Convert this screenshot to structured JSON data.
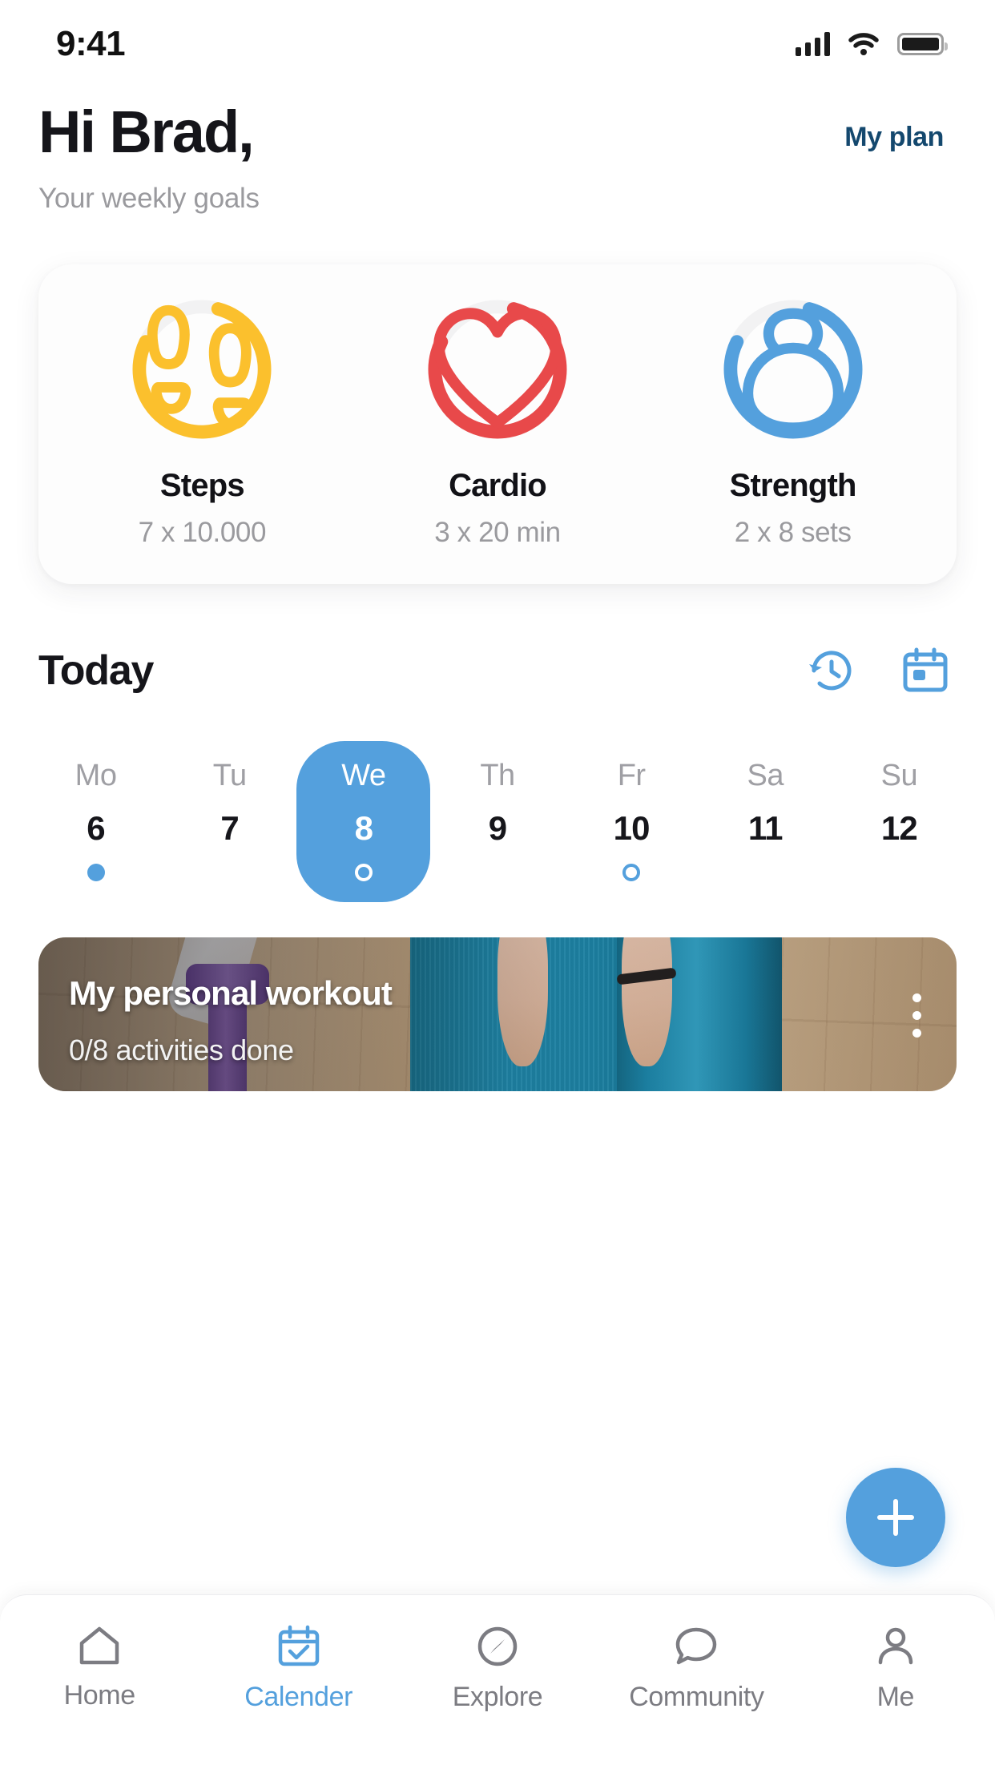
{
  "status": {
    "time": "9:41",
    "signal_icon": "signal-bars-icon",
    "wifi_icon": "wifi-icon",
    "battery_icon": "battery-icon"
  },
  "header": {
    "greeting": "Hi Brad,",
    "subtitle": "Your weekly goals",
    "my_plan_label": "My plan",
    "my_plan_color": "#14486e"
  },
  "goals": [
    {
      "name": "Steps",
      "value": "7 x 10.000",
      "icon": "footprints-icon",
      "color": "#fbc02d",
      "track_color": "#f2f2f3",
      "progress": 78
    },
    {
      "name": "Cardio",
      "value": "3 x 20 min",
      "icon": "heart-icon",
      "color": "#e8494a",
      "track_color": "#f2f2f3",
      "progress": 78
    },
    {
      "name": "Strength",
      "value": "2 x 8 sets",
      "icon": "kettlebell-icon",
      "color": "#54a0dd",
      "track_color": "#f2f2f3",
      "progress": 78
    }
  ],
  "today": {
    "title": "Today",
    "history_icon": "history-clock-icon",
    "calendar_icon": "calendar-icon",
    "icon_color": "#54a0dd"
  },
  "days": [
    {
      "name": "Mo",
      "num": "6",
      "active": false,
      "dot": "filled"
    },
    {
      "name": "Tu",
      "num": "7",
      "active": false,
      "dot": "none"
    },
    {
      "name": "We",
      "num": "8",
      "active": true,
      "dot": "hollow-white"
    },
    {
      "name": "Th",
      "num": "9",
      "active": false,
      "dot": "none"
    },
    {
      "name": "Fr",
      "num": "10",
      "active": false,
      "dot": "hollow-blue"
    },
    {
      "name": "Sa",
      "num": "11",
      "active": false,
      "dot": "none"
    },
    {
      "name": "Su",
      "num": "12",
      "active": false,
      "dot": "none"
    }
  ],
  "workout": {
    "title": "My personal workout",
    "subtitle": "0/8 activities done",
    "more_icon": "more-vertical-icon"
  },
  "fab": {
    "icon": "plus-icon",
    "color": "#54a0dd"
  },
  "tabs": [
    {
      "label": "Home",
      "icon": "home-icon",
      "active": false
    },
    {
      "label": "Calender",
      "icon": "calendar-check-icon",
      "active": true
    },
    {
      "label": "Explore",
      "icon": "compass-icon",
      "active": false
    },
    {
      "label": "Community",
      "icon": "chat-icon",
      "active": false
    },
    {
      "label": "Me",
      "icon": "person-icon",
      "active": false
    }
  ],
  "accent_color": "#54a0dd"
}
